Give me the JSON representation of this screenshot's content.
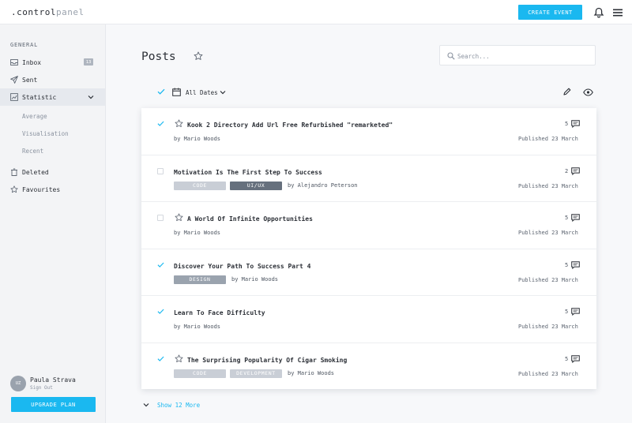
{
  "app": {
    "logo_prefix": ".control",
    "logo_suffix": "panel",
    "create_event_label": "CREATE EVENT"
  },
  "sidebar": {
    "section_label": "GENERAL",
    "items": [
      {
        "label": "Inbox",
        "icon": "inbox-icon",
        "badge": "13"
      },
      {
        "label": "Sent",
        "icon": "send-icon"
      },
      {
        "label": "Statistic",
        "icon": "chart-icon",
        "active": true
      },
      {
        "label": "Deleted",
        "icon": "trash-icon"
      },
      {
        "label": "Favourites",
        "icon": "star-icon"
      }
    ],
    "sub_items": [
      "Average",
      "Visualisation",
      "Recent"
    ],
    "user": {
      "initials": "UZ",
      "name": "Paula Strava",
      "action": "Sign Out"
    },
    "upgrade_label": "UPGRADE PLAN"
  },
  "main": {
    "title": "Posts",
    "search_placeholder": "Search...",
    "date_filter": "All Dates",
    "show_more": "Show 12 More",
    "posts": [
      {
        "title": "Kook 2 Directory Add Url Free Refurbished  \"remarketed\"",
        "checked": true,
        "starred": true,
        "tags": [],
        "author": "by Mario Woods",
        "comments": "5",
        "published": "Published 23 March"
      },
      {
        "title": "Motivation Is The First Step To Success",
        "checked": false,
        "starred": false,
        "tags": [
          "CODE",
          "UI/UX"
        ],
        "author": "by Alejandro Peterson",
        "comments": "2",
        "published": "Published 23 March"
      },
      {
        "title": "A World Of Infinite Opportunities",
        "checked": false,
        "starred": true,
        "tags": [],
        "author": "by Mario Woods",
        "comments": "5",
        "published": "Published 23 March"
      },
      {
        "title": "Discover Your Path To Success Part 4",
        "checked": true,
        "starred": false,
        "tags": [
          "DESIGN"
        ],
        "author": "by Mario Woods",
        "comments": "5",
        "published": "Published 23 March"
      },
      {
        "title": "Learn To Face Difficulty",
        "checked": true,
        "starred": false,
        "tags": [],
        "author": "by Mario Woods",
        "comments": "5",
        "published": "Published 23 March"
      },
      {
        "title": "The Surprising Popularity Of Cigar Smoking",
        "checked": true,
        "starred": true,
        "tags": [
          "CODE",
          "DEVELOPMENT"
        ],
        "author": "by Mario Woods",
        "comments": "5",
        "published": "Published 23 March"
      }
    ]
  },
  "colors": {
    "accent": "#1ab8f0"
  }
}
